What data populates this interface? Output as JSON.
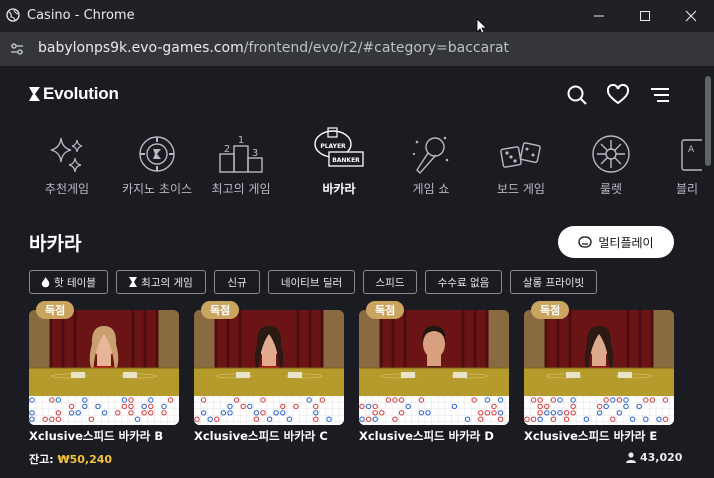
{
  "window": {
    "title": "Casino - Chrome",
    "url_host": "babylonps9k.evo-games.com",
    "url_path": "/frontend/evo/r2/#category=baccarat"
  },
  "header": {
    "brand": "Evolution"
  },
  "categories": [
    {
      "label": "추천게임",
      "icon": "sparkles-icon"
    },
    {
      "label": "카지노 초이스",
      "icon": "chip-icon"
    },
    {
      "label": "최고의 게임",
      "icon": "podium-icon"
    },
    {
      "label": "바카라",
      "icon": "baccarat-icon",
      "active": true
    },
    {
      "label": "게임 쇼",
      "icon": "microphone-icon"
    },
    {
      "label": "보드 게임",
      "icon": "dice-icon"
    },
    {
      "label": "룰렛",
      "icon": "roulette-icon"
    },
    {
      "label": "블리",
      "icon": "cards-icon"
    }
  ],
  "section": {
    "title": "바카라",
    "multi_play_label": "멀티플레이"
  },
  "filters": [
    {
      "label": "핫 테이블",
      "icon": "flame-icon"
    },
    {
      "label": "최고의 게임",
      "icon": "evo-icon"
    },
    {
      "label": "신규"
    },
    {
      "label": "네이티브 딜러"
    },
    {
      "label": "스피드"
    },
    {
      "label": "수수료 없음"
    },
    {
      "label": "살롱 프라이빗"
    }
  ],
  "tables": [
    {
      "badge": "독점",
      "name": "Xclusive스피드 바카라 B"
    },
    {
      "badge": "독점",
      "name": "Xclusive스피드 바카라 C"
    },
    {
      "badge": "독점",
      "name": "Xclusive스피드 바카라 D"
    },
    {
      "badge": "독점",
      "name": "Xclusive스피드 바카라 E"
    }
  ],
  "footer": {
    "balance_label": "잔고:",
    "balance_amount": "₩50,240",
    "players": "43,020"
  },
  "colors": {
    "page_bg": "#1b1b22",
    "badge": "#c9a560",
    "balance": "#f3c13a",
    "felt": "#b59a2c",
    "curtain": "#6a1416"
  }
}
